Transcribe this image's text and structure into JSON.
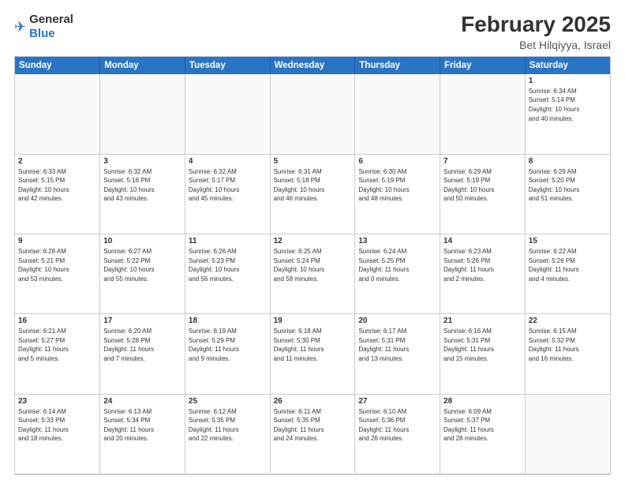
{
  "header": {
    "logo_general": "General",
    "logo_blue": "Blue",
    "month": "February 2025",
    "location": "Bet Hilqiyya, Israel"
  },
  "weekdays": [
    "Sunday",
    "Monday",
    "Tuesday",
    "Wednesday",
    "Thursday",
    "Friday",
    "Saturday"
  ],
  "weeks": [
    [
      {
        "day": "",
        "info": ""
      },
      {
        "day": "",
        "info": ""
      },
      {
        "day": "",
        "info": ""
      },
      {
        "day": "",
        "info": ""
      },
      {
        "day": "",
        "info": ""
      },
      {
        "day": "",
        "info": ""
      },
      {
        "day": "1",
        "info": "Sunrise: 6:34 AM\nSunset: 5:14 PM\nDaylight: 10 hours\nand 40 minutes."
      }
    ],
    [
      {
        "day": "2",
        "info": "Sunrise: 6:33 AM\nSunset: 5:15 PM\nDaylight: 10 hours\nand 42 minutes."
      },
      {
        "day": "3",
        "info": "Sunrise: 6:32 AM\nSunset: 5:16 PM\nDaylight: 10 hours\nand 43 minutes."
      },
      {
        "day": "4",
        "info": "Sunrise: 6:32 AM\nSunset: 5:17 PM\nDaylight: 10 hours\nand 45 minutes."
      },
      {
        "day": "5",
        "info": "Sunrise: 6:31 AM\nSunset: 5:18 PM\nDaylight: 10 hours\nand 46 minutes."
      },
      {
        "day": "6",
        "info": "Sunrise: 6:30 AM\nSunset: 5:19 PM\nDaylight: 10 hours\nand 48 minutes."
      },
      {
        "day": "7",
        "info": "Sunrise: 6:29 AM\nSunset: 5:19 PM\nDaylight: 10 hours\nand 50 minutes."
      },
      {
        "day": "8",
        "info": "Sunrise: 6:29 AM\nSunset: 5:20 PM\nDaylight: 10 hours\nand 51 minutes."
      }
    ],
    [
      {
        "day": "9",
        "info": "Sunrise: 6:28 AM\nSunset: 5:21 PM\nDaylight: 10 hours\nand 53 minutes."
      },
      {
        "day": "10",
        "info": "Sunrise: 6:27 AM\nSunset: 5:22 PM\nDaylight: 10 hours\nand 55 minutes."
      },
      {
        "day": "11",
        "info": "Sunrise: 6:26 AM\nSunset: 5:23 PM\nDaylight: 10 hours\nand 56 minutes."
      },
      {
        "day": "12",
        "info": "Sunrise: 6:25 AM\nSunset: 5:24 PM\nDaylight: 10 hours\nand 58 minutes."
      },
      {
        "day": "13",
        "info": "Sunrise: 6:24 AM\nSunset: 5:25 PM\nDaylight: 11 hours\nand 0 minutes."
      },
      {
        "day": "14",
        "info": "Sunrise: 6:23 AM\nSunset: 5:26 PM\nDaylight: 11 hours\nand 2 minutes."
      },
      {
        "day": "15",
        "info": "Sunrise: 6:22 AM\nSunset: 5:26 PM\nDaylight: 11 hours\nand 4 minutes."
      }
    ],
    [
      {
        "day": "16",
        "info": "Sunrise: 6:21 AM\nSunset: 5:27 PM\nDaylight: 11 hours\nand 5 minutes."
      },
      {
        "day": "17",
        "info": "Sunrise: 6:20 AM\nSunset: 5:28 PM\nDaylight: 11 hours\nand 7 minutes."
      },
      {
        "day": "18",
        "info": "Sunrise: 6:19 AM\nSunset: 5:29 PM\nDaylight: 11 hours\nand 9 minutes."
      },
      {
        "day": "19",
        "info": "Sunrise: 6:18 AM\nSunset: 5:30 PM\nDaylight: 11 hours\nand 11 minutes."
      },
      {
        "day": "20",
        "info": "Sunrise: 6:17 AM\nSunset: 5:31 PM\nDaylight: 11 hours\nand 13 minutes."
      },
      {
        "day": "21",
        "info": "Sunrise: 6:16 AM\nSunset: 5:31 PM\nDaylight: 11 hours\nand 15 minutes."
      },
      {
        "day": "22",
        "info": "Sunrise: 6:15 AM\nSunset: 5:32 PM\nDaylight: 11 hours\nand 16 minutes."
      }
    ],
    [
      {
        "day": "23",
        "info": "Sunrise: 6:14 AM\nSunset: 5:33 PM\nDaylight: 11 hours\nand 18 minutes."
      },
      {
        "day": "24",
        "info": "Sunrise: 6:13 AM\nSunset: 5:34 PM\nDaylight: 11 hours\nand 20 minutes."
      },
      {
        "day": "25",
        "info": "Sunrise: 6:12 AM\nSunset: 5:35 PM\nDaylight: 11 hours\nand 22 minutes."
      },
      {
        "day": "26",
        "info": "Sunrise: 6:11 AM\nSunset: 5:35 PM\nDaylight: 11 hours\nand 24 minutes."
      },
      {
        "day": "27",
        "info": "Sunrise: 6:10 AM\nSunset: 5:36 PM\nDaylight: 11 hours\nand 26 minutes."
      },
      {
        "day": "28",
        "info": "Sunrise: 6:09 AM\nSunset: 5:37 PM\nDaylight: 11 hours\nand 28 minutes."
      },
      {
        "day": "",
        "info": ""
      }
    ]
  ]
}
